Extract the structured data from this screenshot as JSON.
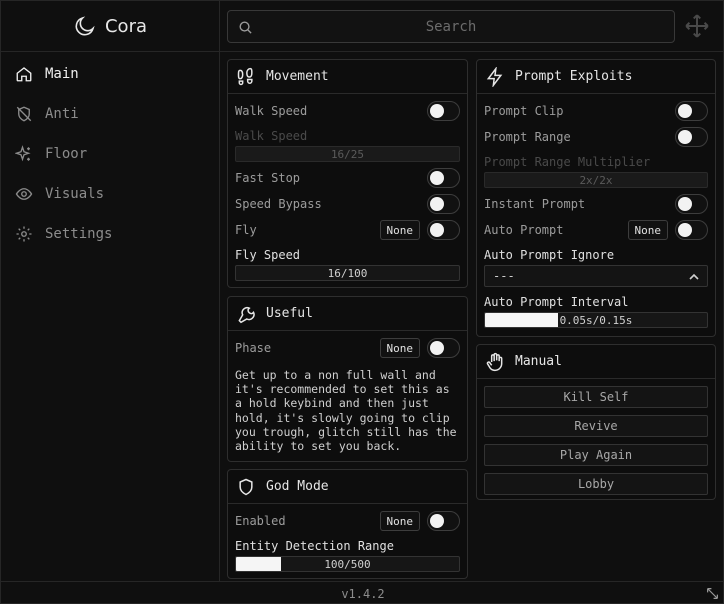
{
  "app": {
    "title": "Cora",
    "version": "v1.4.2"
  },
  "search": {
    "placeholder": "Search"
  },
  "sidebar": {
    "items": [
      {
        "label": "Main",
        "icon": "home-icon",
        "active": true
      },
      {
        "label": "Anti",
        "icon": "shield-off-icon",
        "active": false
      },
      {
        "label": "Floor",
        "icon": "sparkles-icon",
        "active": false
      },
      {
        "label": "Visuals",
        "icon": "eye-icon",
        "active": false
      },
      {
        "label": "Settings",
        "icon": "gear-icon",
        "active": false
      }
    ]
  },
  "movement": {
    "title": "Movement",
    "icon": "footprints-icon",
    "walk_speed": "Walk Speed",
    "walk_speed_slider_label": "Walk Speed",
    "walk_speed_value": "16/25",
    "fast_stop": "Fast Stop",
    "speed_bypass": "Speed Bypass",
    "fly": "Fly",
    "fly_keybind": "None",
    "fly_speed": "Fly Speed",
    "fly_speed_value": "16/100"
  },
  "useful": {
    "title": "Useful",
    "icon": "wrench-icon",
    "phase": "Phase",
    "phase_keybind": "None",
    "description": "Get up to a non full wall and\nit's recommended to set this as\na hold keybind and then just\nhold, it's slowly going to clip\nyou trough, glitch still has the\nability to set you back."
  },
  "god_mode": {
    "title": "God Mode",
    "icon": "shield-icon",
    "enabled": "Enabled",
    "enabled_keybind": "None",
    "entity_range": "Entity Detection Range",
    "entity_range_value": "100/500",
    "entity_range_fraction": 0.2
  },
  "prompt": {
    "title": "Prompt Exploits",
    "icon": "lightning-icon",
    "clip": "Prompt Clip",
    "range": "Prompt Range",
    "multiplier": "Prompt Range Multiplier",
    "multiplier_value": "2x/2x",
    "instant": "Instant Prompt",
    "auto": "Auto Prompt",
    "auto_keybind": "None",
    "ignore": "Auto Prompt Ignore",
    "ignore_value": "---",
    "interval": "Auto Prompt Interval",
    "interval_value": "0.05s/0.15s",
    "interval_fraction": 0.33
  },
  "manual": {
    "title": "Manual",
    "icon": "hand-icon",
    "buttons": [
      "Kill Self",
      "Revive",
      "Play Again",
      "Lobby"
    ]
  }
}
